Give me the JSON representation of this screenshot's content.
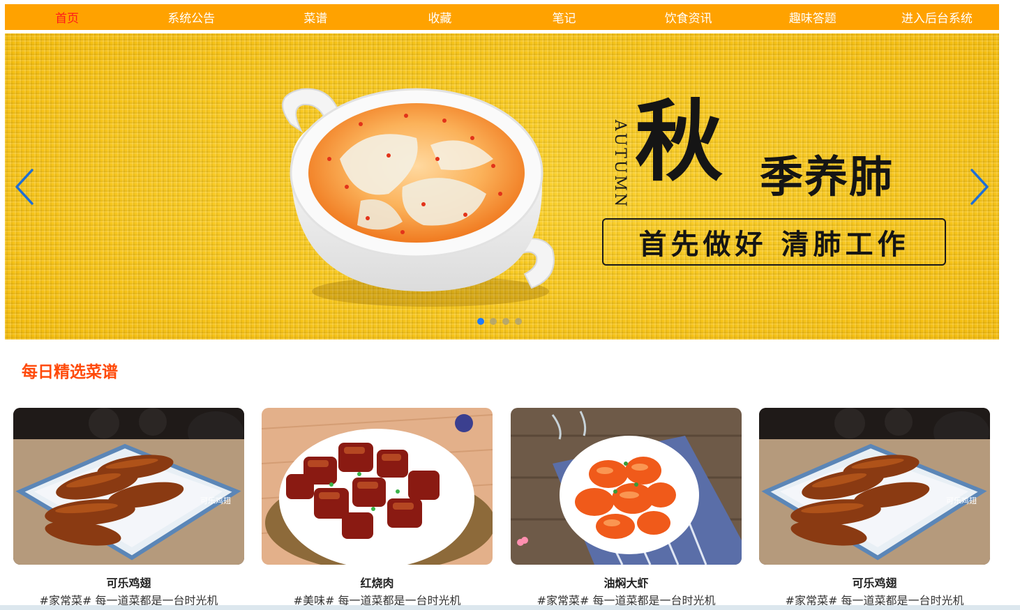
{
  "nav": {
    "items": [
      {
        "label": "首页",
        "active": true
      },
      {
        "label": "系统公告"
      },
      {
        "label": "菜谱"
      },
      {
        "label": "收藏"
      },
      {
        "label": "笔记"
      },
      {
        "label": "饮食资讯"
      },
      {
        "label": "趣味答题"
      },
      {
        "label": "进入后台系统"
      }
    ],
    "bg_color": "#ffa200",
    "active_color": "#ff1a1a"
  },
  "banner": {
    "autumn": "AUTUMN",
    "big_char": "秋",
    "sub_heading": "季养肺",
    "slogan": "首先做好 清肺工作",
    "prev_icon": "chevron-left-icon",
    "next_icon": "chevron-right-icon",
    "slides_total": 4,
    "active_slide": 1
  },
  "section": {
    "title": "每日精选菜谱"
  },
  "recipes": [
    {
      "title": "可乐鸡翅",
      "desc": "#家常菜# 每一道菜都是一台时光机",
      "watermark": "可乐鸡翅"
    },
    {
      "title": "红烧肉",
      "desc": "#美味# 每一道菜都是一台时光机"
    },
    {
      "title": "油焖大虾",
      "desc": "#家常菜# 每一道菜都是一台时光机"
    },
    {
      "title": "可乐鸡翅",
      "desc": "#家常菜# 每一道菜都是一台时光机",
      "watermark": "可乐鸡翅"
    }
  ]
}
